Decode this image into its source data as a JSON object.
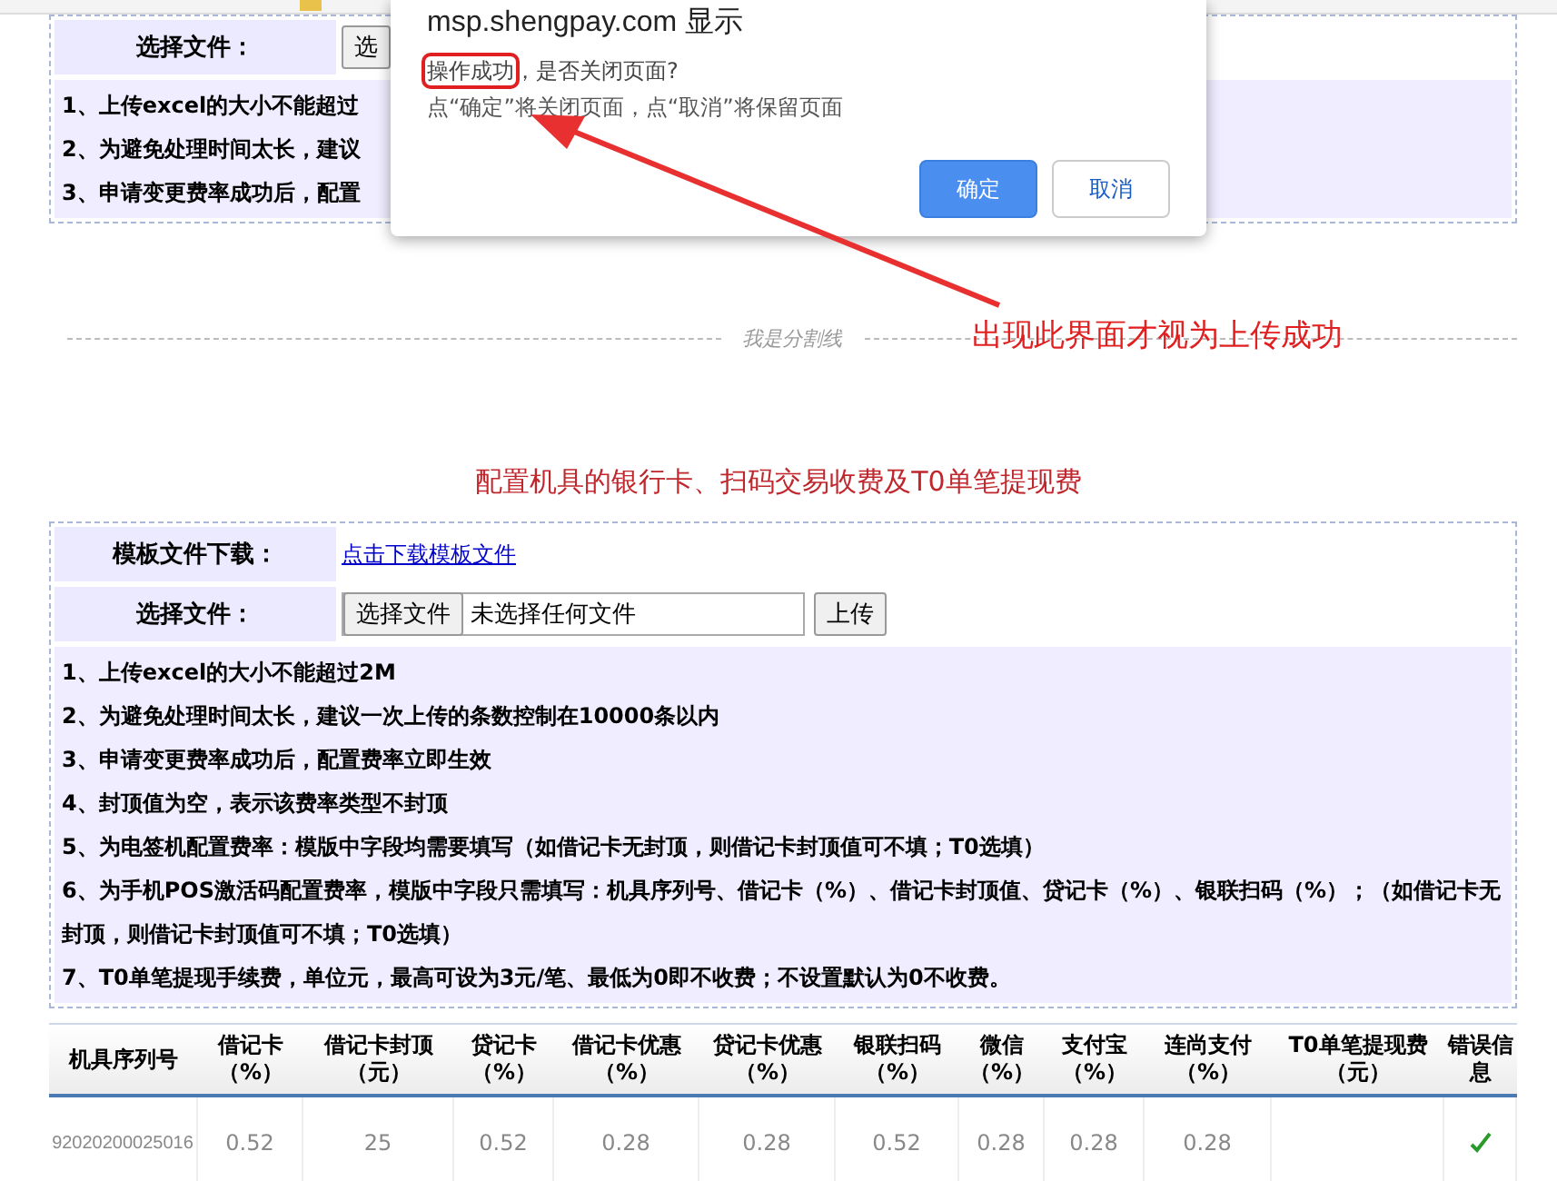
{
  "top_panel": {
    "file_label": "选择文件：",
    "choose_button": "选",
    "notes": [
      "1、上传excel的大小不能超过",
      "2、为避免处理时间太长，建议",
      "3、申请变更费率成功后，配置"
    ]
  },
  "dialog": {
    "title": "msp.shengpay.com 显示",
    "message_highlight": "操作成功",
    "message_rest": "，是否关闭页面?",
    "hint": "点“确定”将关闭页面，点“取消”将保留页面",
    "buttons": [
      {
        "label": "确定",
        "kind": "primary"
      },
      {
        "label": "取消",
        "kind": "secondary"
      }
    ]
  },
  "annotation": {
    "text": "出现此界面才视为上传成功"
  },
  "divider": {
    "label": "我是分割线"
  },
  "section_title": "配置机具的银行卡、扫码交易收费及T0单笔提现费",
  "form": {
    "template_label": "模板文件下载：",
    "template_link": "点击下载模板文件",
    "file_label": "选择文件：",
    "choose_button": "选择文件",
    "file_status": "未选择任何文件",
    "upload_button": "上传"
  },
  "notes": [
    "1、上传excel的大小不能超过2M",
    "2、为避免处理时间太长，建议一次上传的条数控制在10000条以内",
    "3、申请变更费率成功后，配置费率立即生效",
    "4、封顶值为空，表示该费率类型不封顶",
    "5、为电签机配置费率：模版中字段均需要填写（如借记卡无封顶，则借记卡封顶值可不填；T0选填）",
    "6、为手机POS激活码配置费率，模版中字段只需填写：机具序列号、借记卡（%）、借记卡封顶值、贷记卡（%）、银联扫码（%）；（如借记卡无封顶，则借记卡封顶值可不填；T0选填）",
    "7、T0单笔提现手续费，单位元，最高可设为3元/笔、最低为0即不收费；不设置默认为0不收费。"
  ],
  "table": {
    "columns": [
      {
        "label": "机具序列号"
      },
      {
        "label": "借记卡",
        "unit": "（%）"
      },
      {
        "label": "借记卡封顶",
        "unit": "（元）"
      },
      {
        "label": "贷记卡",
        "unit": "（%）"
      },
      {
        "label": "借记卡优惠",
        "unit": "（%）"
      },
      {
        "label": "贷记卡优惠",
        "unit": "（%）"
      },
      {
        "label": "银联扫码",
        "unit": "（%）"
      },
      {
        "label": "微信",
        "unit": "（%）"
      },
      {
        "label": "支付宝",
        "unit": "（%）"
      },
      {
        "label": "连尚支付",
        "unit": "（%）"
      },
      {
        "label": "T0单笔提现费",
        "unit": "（元）"
      },
      {
        "label": "错误信息"
      }
    ],
    "rows": [
      {
        "cells": [
          "92020200025016",
          "0.52",
          "25",
          "0.52",
          "0.28",
          "0.28",
          "0.52",
          "0.28",
          "0.28",
          "0.28",
          ""
        ],
        "ok": true
      }
    ]
  }
}
